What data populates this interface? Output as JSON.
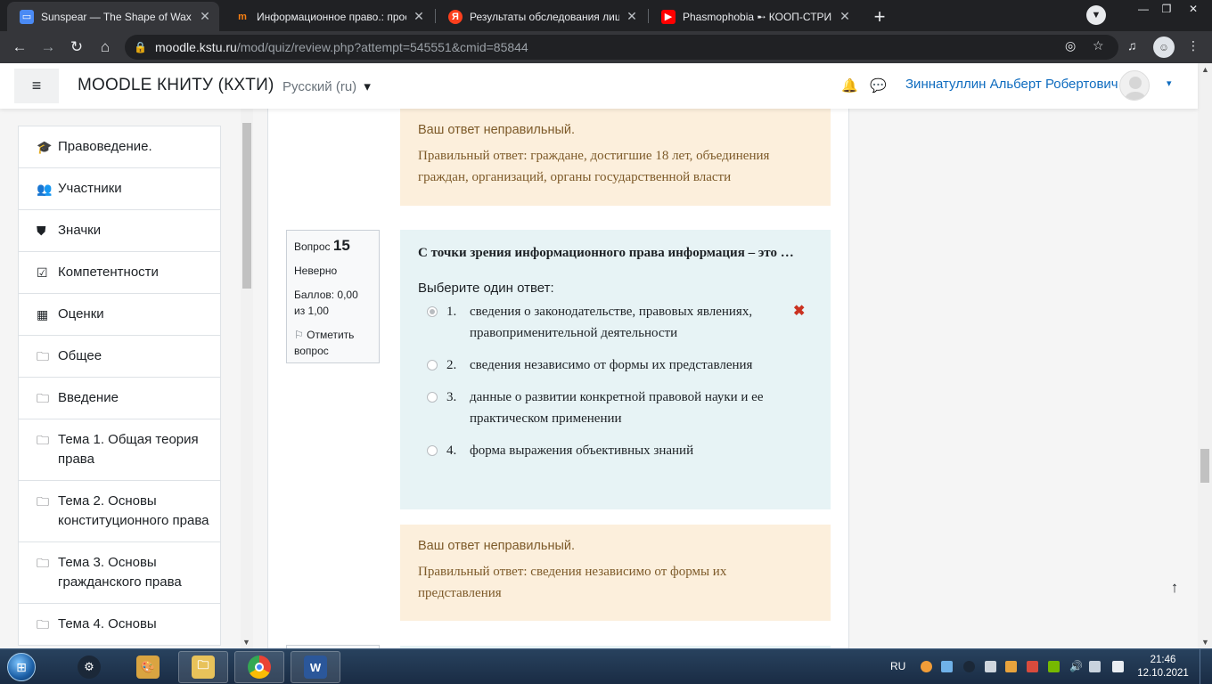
{
  "browser": {
    "tabs": [
      {
        "title": "Sunspear — The Shape of Wax",
        "close": "✕"
      },
      {
        "title": "Информационное право.: просмо",
        "close": "✕"
      },
      {
        "title": "Результаты обследования лица, ",
        "close": "✕"
      },
      {
        "title": "Phasmophobia ➸ КООП-СТРИМ ",
        "close": "✕"
      }
    ],
    "new_tab": "+",
    "url_host": "moodle.kstu.ru",
    "url_path": "/mod/quiz/review.php?attempt=545551&cmid=85844"
  },
  "navbar": {
    "site_name": "MOODLE КНИТУ (КХТИ)",
    "language": "Русский (ru)",
    "language_caret": "▾",
    "user_name": "Зиннатуллин Альберт Робертович",
    "user_caret": "▾"
  },
  "drawer": {
    "items": [
      {
        "icon": "graduation-cap-icon",
        "glyph": "🎓",
        "label": "Правоведение."
      },
      {
        "icon": "users-icon",
        "glyph": "👥",
        "label": "Участники"
      },
      {
        "icon": "shield-icon",
        "glyph": "⛊",
        "label": "Значки"
      },
      {
        "icon": "checkbox-icon",
        "glyph": "☑",
        "label": "Компетентности"
      },
      {
        "icon": "table-icon",
        "glyph": "▦",
        "label": "Оценки"
      },
      {
        "icon": "folder-icon",
        "glyph": "🗀",
        "label": "Общее"
      },
      {
        "icon": "folder-icon",
        "glyph": "🗀",
        "label": "Введение"
      },
      {
        "icon": "folder-icon",
        "glyph": "🗀",
        "label": "Тема 1. Общая теория права"
      },
      {
        "icon": "folder-icon",
        "glyph": "🗀",
        "label": "Тема 2. Основы конституционного права"
      },
      {
        "icon": "folder-icon",
        "glyph": "🗀",
        "label": "Тема 3. Основы гражданского права"
      },
      {
        "icon": "folder-icon",
        "glyph": "🗀",
        "label": "Тема 4. Основы"
      }
    ]
  },
  "prev_feedback": {
    "verdict": "Ваш ответ неправильный.",
    "right_answer": "Правильный ответ: граждане, достигшие 18 лет, объединения граждан, организаций, органы государственной власти"
  },
  "question": {
    "label": "Вопрос",
    "number": "15",
    "state": "Неверно",
    "grade": "Баллов: 0,00 из 1,00",
    "flag": "Отметить вопрос",
    "text": "С точки зрения информационного права информация – это …",
    "prompt": "Выберите один ответ:",
    "answers": [
      {
        "num": "1.",
        "text": "сведения о законодательстве, правовых явлениях, правоприменительной деятельности",
        "selected": true,
        "mark": "✖"
      },
      {
        "num": "2.",
        "text": "сведения независимо от формы их представления",
        "selected": false,
        "mark": ""
      },
      {
        "num": "3.",
        "text": "данные о развитии конкретной правовой науки и ее практическом применении",
        "selected": false,
        "mark": ""
      },
      {
        "num": "4.",
        "text": "форма выражения объективных знаний",
        "selected": false,
        "mark": ""
      }
    ]
  },
  "feedback": {
    "verdict": "Ваш ответ неправильный.",
    "right_answer": "Правильный ответ: сведения независимо от формы их представления"
  },
  "taskbar": {
    "language": "RU",
    "time": "21:46",
    "date": "12.10.2021"
  },
  "colors": {
    "link": "#0f6cbf",
    "feedback_bg": "#fcefdc",
    "question_bg": "#e7f3f5",
    "wrong": "#ca3120"
  }
}
